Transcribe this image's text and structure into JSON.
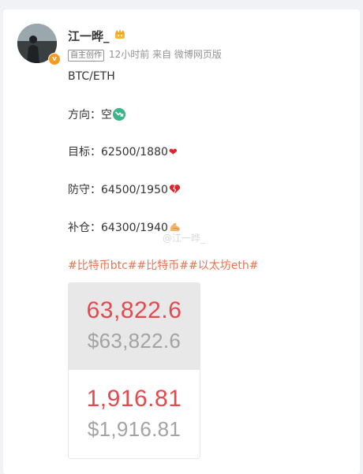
{
  "post": {
    "username": "江一晔_",
    "crown_icon": "crown-icon",
    "verified_icon": "verified-v-icon",
    "badge": "自主创作",
    "time": "12小时前",
    "source": "来自 微博网页版",
    "lines": {
      "pair": "BTC/ETH",
      "direction": "方向：空",
      "target": "目标：62500/1880",
      "stop": "防守：64500/1950",
      "add": "补仓：64300/1940"
    },
    "icons": {
      "direction": "down-arrow-icon",
      "target": "heart-icon",
      "stop": "broken-heart-icon",
      "add": "muscle-icon"
    },
    "watermark": "@江一晔_",
    "hashtags": [
      "#比特币btc#",
      "#比特币#",
      "#以太坊eth#"
    ]
  },
  "image": {
    "btc_price": "63,822.6",
    "btc_price_usd": "$63,822.6",
    "eth_price": "1,916.81",
    "eth_price_usd": "$1,916.81"
  },
  "colors": {
    "link": "#eb7350",
    "price_red": "#e5484d",
    "price_grey": "#a3a3a3",
    "verified": "#f79b1f",
    "direction_icon": "#3bb68a"
  }
}
